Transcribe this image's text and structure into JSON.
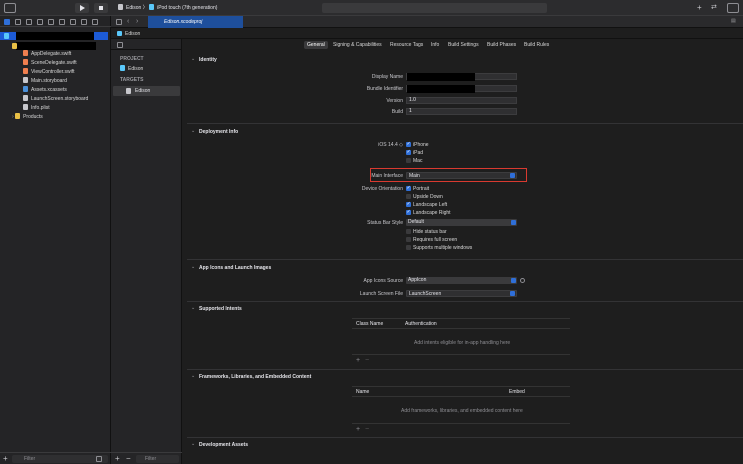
{
  "toolbar": {
    "scheme": "Edison",
    "device": "iPod touch (7th generation)"
  },
  "tabs": {
    "active_file": "Edison.xcodeproj"
  },
  "breadcrumb": "Edison",
  "navigator": {
    "files": [
      "AppDelegate.swift",
      "SceneDelegate.swift",
      "ViewController.swift",
      "Main.storyboard",
      "Assets.xcassets",
      "LaunchScreen.storyboard",
      "Info.plist"
    ],
    "products": "Products",
    "filter_placeholder": "Filter"
  },
  "targets_panel": {
    "project_header": "PROJECT",
    "project_name": "Edison",
    "targets_header": "TARGETS",
    "target_name": "Edison",
    "filter_placeholder": "Filter"
  },
  "settings_tabs": [
    "General",
    "Signing & Capabilities",
    "Resource Tags",
    "Info",
    "Build Settings",
    "Build Phases",
    "Build Rules"
  ],
  "identity": {
    "title": "Identity",
    "display_name_label": "Display Name",
    "bundle_id_label": "Bundle Identifier",
    "version_label": "Version",
    "version_value": "1.0",
    "build_label": "Build",
    "build_value": "1"
  },
  "deployment": {
    "title": "Deployment Info",
    "ios_label": "iOS 14.4 ◇",
    "devices": [
      "iPhone",
      "iPad",
      "Mac"
    ],
    "main_interface_label": "Main Interface",
    "main_interface_value": "Main",
    "orientation_label": "Device Orientation",
    "orientations": [
      "Portrait",
      "Upside Down",
      "Landscape Left",
      "Landscape Right"
    ],
    "status_bar_label": "Status Bar Style",
    "status_bar_value": "Default",
    "status_options": [
      "Hide status bar",
      "Requires full screen",
      "Supports multiple windows"
    ],
    "highlight_color": "#d93a30"
  },
  "app_icons": {
    "title": "App Icons and Launch Images",
    "icons_source_label": "App Icons Source",
    "icons_source_value": "AppIcon",
    "launch_file_label": "Launch Screen File",
    "launch_file_value": "LaunchScreen"
  },
  "intents": {
    "title": "Supported Intents",
    "col_class": "Class Name",
    "col_auth": "Authentication",
    "empty": "Add intents eligible for in-app handling here"
  },
  "frameworks": {
    "title": "Frameworks, Libraries, and Embedded Content",
    "col_name": "Name",
    "col_embed": "Embed",
    "empty": "Add frameworks, libraries, and embedded content here"
  },
  "dev_assets": {
    "title": "Development Assets"
  },
  "colors": {
    "accent": "#2f6fd8",
    "selection": "#1d5bd6"
  }
}
